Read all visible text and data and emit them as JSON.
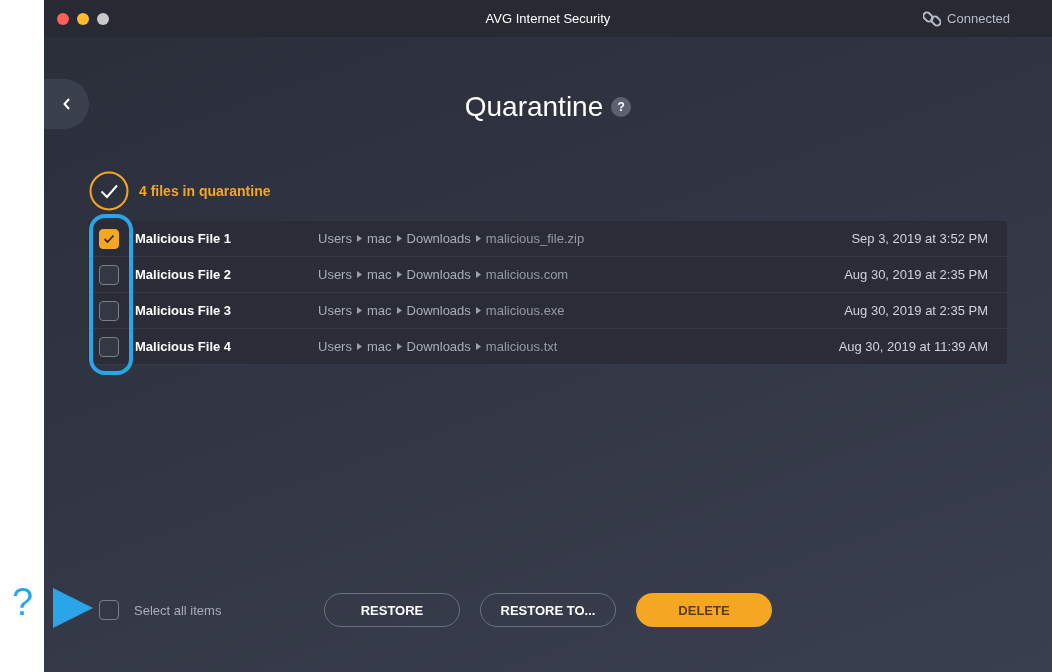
{
  "window": {
    "title": "AVG Internet Security"
  },
  "connection": {
    "label": "Connected"
  },
  "page": {
    "title": "Quarantine",
    "help": "?"
  },
  "summary": "4 files in quarantine",
  "files": [
    {
      "name": "Malicious File 1",
      "path": [
        "Users",
        "mac",
        "Downloads",
        "malicious_file.zip"
      ],
      "date": "Sep 3, 2019 at 3:52 PM",
      "checked": true
    },
    {
      "name": "Malicious File 2",
      "path": [
        "Users",
        "mac",
        "Downloads",
        "malicious.com"
      ],
      "date": "Aug 30, 2019 at 2:35 PM",
      "checked": false
    },
    {
      "name": "Malicious File 3",
      "path": [
        "Users",
        "mac",
        "Downloads",
        "malicious.exe"
      ],
      "date": "Aug 30, 2019 at 2:35 PM",
      "checked": false
    },
    {
      "name": "Malicious File 4",
      "path": [
        "Users",
        "mac",
        "Downloads",
        "malicious.txt"
      ],
      "date": "Aug 30, 2019 at 11:39 AM",
      "checked": false
    }
  ],
  "select_all": {
    "label": "Select all items",
    "checked": false
  },
  "buttons": [
    {
      "label": "RESTORE",
      "kind": "outline"
    },
    {
      "label": "RESTORE TO...",
      "kind": "outline"
    },
    {
      "label": "DELETE",
      "kind": "primary"
    }
  ],
  "annotation": {
    "mark": "?"
  }
}
